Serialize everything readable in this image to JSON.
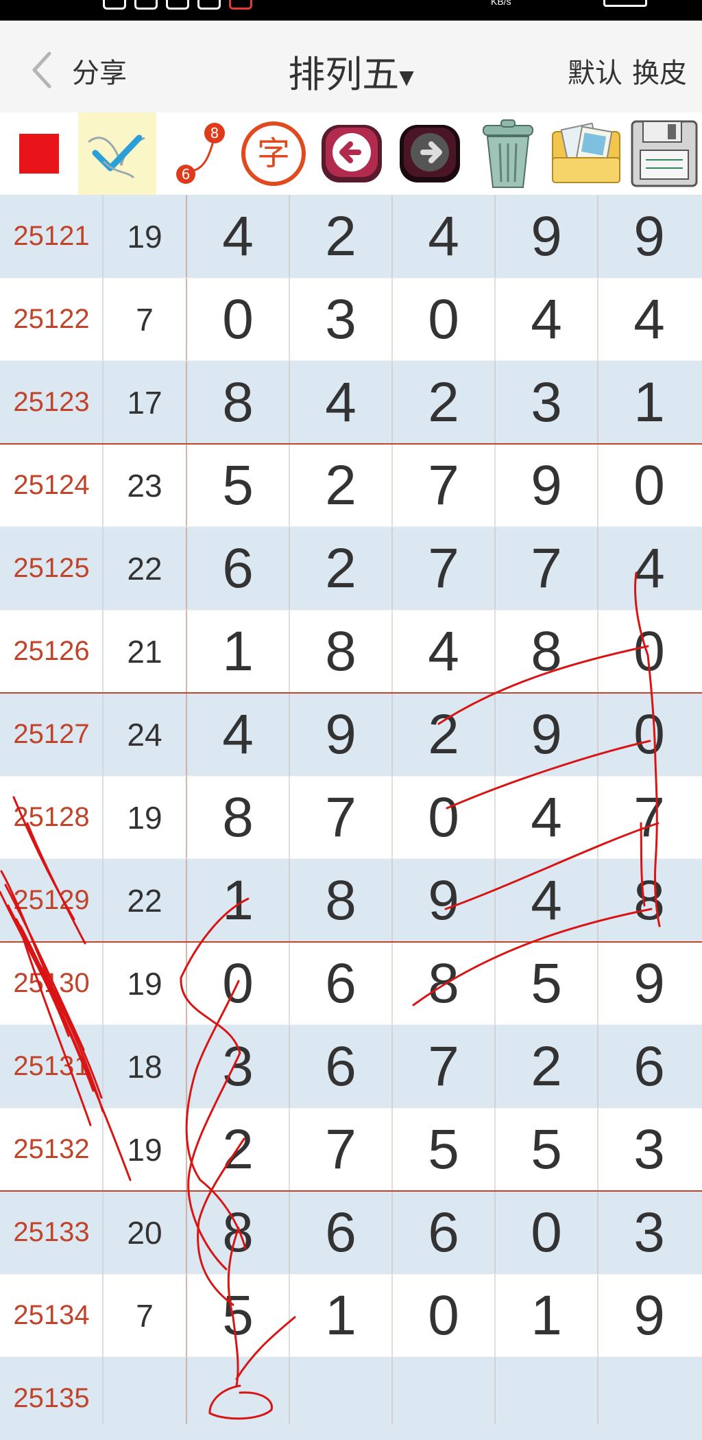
{
  "status_bar": {
    "net_speed": "KB/s"
  },
  "header": {
    "back_label": "分享",
    "title": "排列五",
    "actions": [
      "默认",
      "换皮"
    ]
  },
  "toolbar": {
    "tools": [
      {
        "name": "red-square-icon"
      },
      {
        "name": "checkmark-brush-icon"
      },
      {
        "name": "connect-6-8-icon",
        "label_a": "8",
        "label_b": "6"
      },
      {
        "name": "text-char-icon",
        "label": "字"
      },
      {
        "name": "back-arrow-icon"
      },
      {
        "name": "forward-arrow-icon"
      },
      {
        "name": "trash-can-icon"
      },
      {
        "name": "photo-folder-icon"
      },
      {
        "name": "save-floppy-icon"
      }
    ]
  },
  "draws": [
    {
      "issue": "25121",
      "sum": "19",
      "digits": [
        "4",
        "2",
        "4",
        "9",
        "9"
      ]
    },
    {
      "issue": "25122",
      "sum": "7",
      "digits": [
        "0",
        "3",
        "0",
        "4",
        "4"
      ]
    },
    {
      "issue": "25123",
      "sum": "17",
      "digits": [
        "8",
        "4",
        "2",
        "3",
        "1"
      ]
    },
    {
      "issue": "25124",
      "sum": "23",
      "digits": [
        "5",
        "2",
        "7",
        "9",
        "0"
      ]
    },
    {
      "issue": "25125",
      "sum": "22",
      "digits": [
        "6",
        "2",
        "7",
        "7",
        "4"
      ]
    },
    {
      "issue": "25126",
      "sum": "21",
      "digits": [
        "1",
        "8",
        "4",
        "8",
        "0"
      ]
    },
    {
      "issue": "25127",
      "sum": "24",
      "digits": [
        "4",
        "9",
        "2",
        "9",
        "0"
      ]
    },
    {
      "issue": "25128",
      "sum": "19",
      "digits": [
        "8",
        "7",
        "0",
        "4",
        "7"
      ]
    },
    {
      "issue": "25129",
      "sum": "22",
      "digits": [
        "1",
        "8",
        "9",
        "4",
        "8"
      ]
    },
    {
      "issue": "25130",
      "sum": "19",
      "digits": [
        "0",
        "6",
        "8",
        "5",
        "9"
      ]
    },
    {
      "issue": "25131",
      "sum": "18",
      "digits": [
        "3",
        "6",
        "7",
        "2",
        "6"
      ]
    },
    {
      "issue": "25132",
      "sum": "19",
      "digits": [
        "2",
        "7",
        "5",
        "5",
        "3"
      ]
    },
    {
      "issue": "25133",
      "sum": "20",
      "digits": [
        "8",
        "6",
        "6",
        "0",
        "3"
      ]
    },
    {
      "issue": "25134",
      "sum": "7",
      "digits": [
        "5",
        "1",
        "0",
        "1",
        "9"
      ]
    },
    {
      "issue": "25135",
      "sum": "",
      "digits": [
        "",
        "",
        "",
        "",
        ""
      ]
    }
  ],
  "colors": {
    "issue_text": "#c0432a",
    "row_alt": "#dce8f1",
    "group_line": "#c0432a",
    "annotation": "#d81414"
  }
}
